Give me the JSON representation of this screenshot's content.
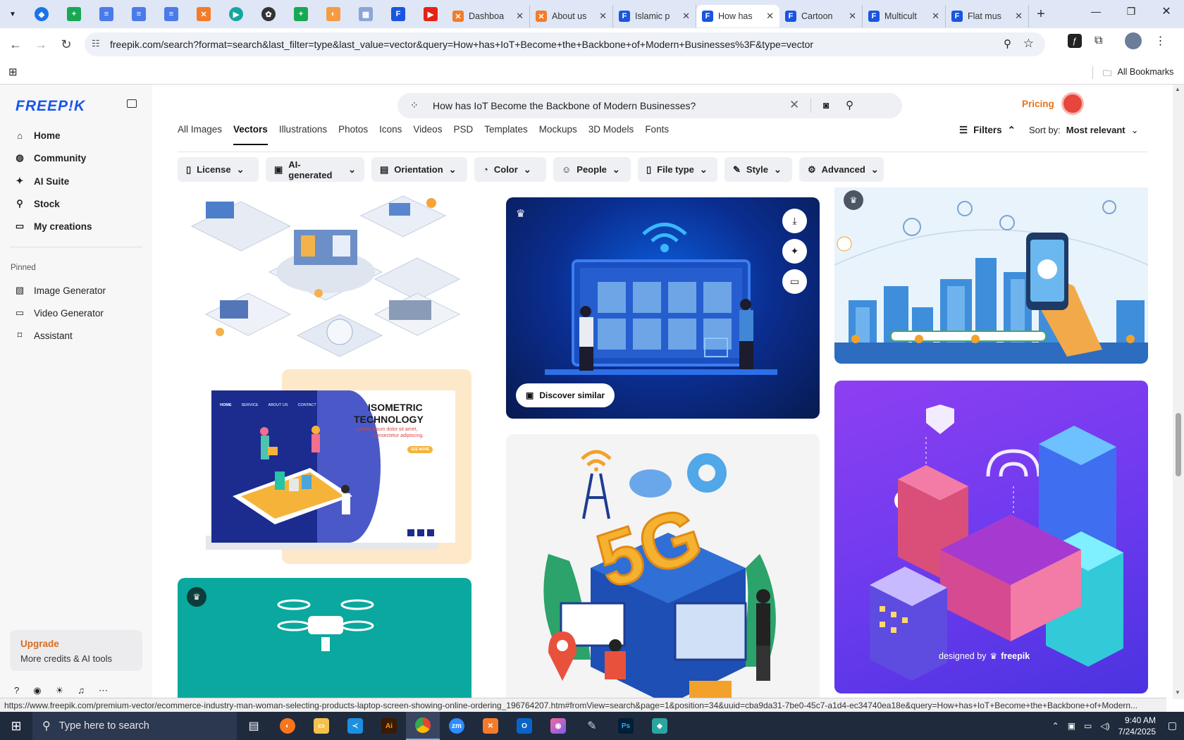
{
  "browser": {
    "tabs": [
      {
        "label": "Dashboa",
        "icon": "xampp-icon"
      },
      {
        "label": "About us",
        "icon": "xampp-icon"
      },
      {
        "label": "Islamic p",
        "icon": "freepik-icon"
      },
      {
        "label": "How has",
        "icon": "freepik-icon"
      },
      {
        "label": "Cartoon",
        "icon": "freepik-icon"
      },
      {
        "label": "Multicult",
        "icon": "freepik-icon"
      },
      {
        "label": "Flat mus",
        "icon": "freepik-icon"
      }
    ],
    "url": "freepik.com/search?format=search&last_filter=type&last_value=vector&query=How+has+IoT+Become+the+Backbone+of+Modern+Businesses%3F&type=vector",
    "bookmarks_label": "All Bookmarks"
  },
  "sidebar": {
    "logo": "FREEP!K",
    "items": [
      {
        "label": "Home",
        "icon": "home-icon"
      },
      {
        "label": "Community",
        "icon": "globe-icon"
      },
      {
        "label": "AI Suite",
        "icon": "sparkle-icon"
      },
      {
        "label": "Stock",
        "icon": "search-icon"
      },
      {
        "label": "My creations",
        "icon": "folder-icon"
      }
    ],
    "pinned_label": "Pinned",
    "pinned": [
      {
        "label": "Image Generator",
        "icon": "image-icon"
      },
      {
        "label": "Video Generator",
        "icon": "video-icon"
      },
      {
        "label": "Assistant",
        "icon": "chat-icon"
      }
    ],
    "upgrade_title": "Upgrade",
    "upgrade_text": "More credits & AI tools"
  },
  "search": {
    "query": "How has IoT Become the Backbone of Modern Businesses?",
    "pricing": "Pricing"
  },
  "type_tabs": [
    "All Images",
    "Vectors",
    "Illustrations",
    "Photos",
    "Icons",
    "Videos",
    "PSD",
    "Templates",
    "Mockups",
    "3D Models",
    "Fonts"
  ],
  "filters_label": "Filters",
  "sort_label": "Sort by:",
  "sort_value": "Most relevant",
  "chips": [
    "License",
    "AI-generated",
    "Orientation",
    "Color",
    "People",
    "File type",
    "Style",
    "Advanced"
  ],
  "results": {
    "discover_similar": "Discover similar",
    "card2_title_l1": "ISOMETRIC",
    "card2_title_l2": "TECHNOLOGY",
    "card2_body_l1": "Lorem ipsum dolor sit amet,",
    "card2_body_l2": "consectetur adipiscing.",
    "card2_button": "SEE MORE",
    "card2_nav": [
      "HOME",
      "SERVICE",
      "ABOUT US",
      "CONTACT"
    ],
    "card_5g_text": "5G",
    "credit": "designed by",
    "credit_brand": "freepik"
  },
  "status_url": "https://www.freepik.com/premium-vector/ecommerce-industry-man-woman-selecting-products-laptop-screen-showing-online-ordering_196764207.htm#fromView=search&page=1&position=34&uuid=cba9da31-7be0-45c7-a1d4-ec34740ea18e&query=How+has+IoT+Become+the+Backbone+of+Modern...",
  "taskbar": {
    "search_placeholder": "Type here to search",
    "time": "9:40 AM",
    "date": "7/24/2025"
  },
  "colors": {
    "brand": "#1657e8",
    "pricing": "#e8731a",
    "upgrade": "#d96b1e",
    "teal_card": "#0aa89e",
    "purple_card": "#7a3ff0"
  }
}
